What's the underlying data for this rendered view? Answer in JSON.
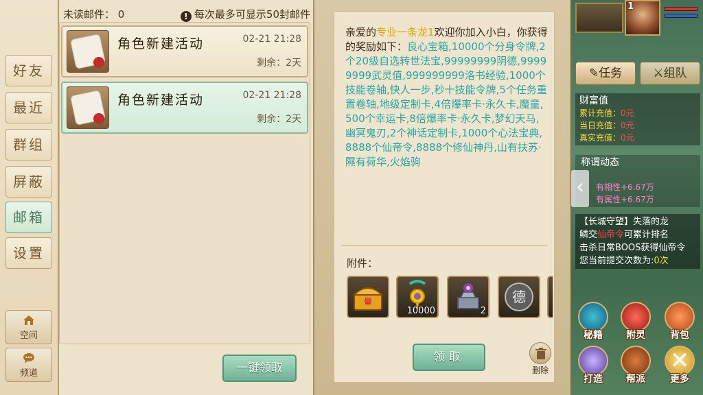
{
  "nav": {
    "tabs": [
      {
        "label": "好友",
        "active": false
      },
      {
        "label": "最近",
        "active": false
      },
      {
        "label": "群组",
        "active": false
      },
      {
        "label": "屏蔽",
        "active": false
      },
      {
        "label": "邮箱",
        "active": true
      },
      {
        "label": "设置",
        "active": false
      }
    ],
    "space_label": "空间",
    "channel_label": "频道"
  },
  "mail": {
    "unread_label": "未读邮件：",
    "unread_count": "0",
    "limit_notice": "每次最多可显示50封邮件",
    "items": [
      {
        "title": "角色新建活动",
        "date": "02-21 21:28",
        "remaining": "剩余：2天",
        "selected": false
      },
      {
        "title": "角色新建活动",
        "date": "02-21 21:28",
        "remaining": "剩余：2天",
        "selected": true
      }
    ],
    "claim_all_label": "一键领取"
  },
  "detail": {
    "greeting": "亲爱的",
    "player_name": "专业一条龙1",
    "welcome": "欢迎你加入小白，你获得的奖励如下：",
    "rewards": "良心宝箱,10000个分身令牌,2个20级自选转世法宝,99999999阴德,99999999武灵值,999999999洛书经验,1000个技能卷轴,快人一步,秒十技能令牌,5个任务重置卷轴,地级定制卡,4倍爆率卡·永久卡,魔童,500个幸运卡,8倍爆率卡·永久卡,梦幻天马,幽冥鬼刃,2个神话定制卡,1000个心法宝典,8888个仙帝令,8888个修仙神丹,山有扶苏·隰有荷华,火焰驹",
    "attachments_label": "附件：",
    "attachments": [
      {
        "icon": "treasure-chest-icon",
        "qty": ""
      },
      {
        "icon": "amulet-icon",
        "qty": "10000"
      },
      {
        "icon": "mystic-altar-icon",
        "qty": "2"
      },
      {
        "icon": "virtue-orb-icon",
        "qty": "",
        "glyph": "德"
      }
    ],
    "claim_label": "领取",
    "delete_label": "删除"
  },
  "hud": {
    "level": "1",
    "quest_tab": "任务",
    "team_tab": "组队",
    "wealth": {
      "title": "财富值",
      "rows": [
        {
          "label": "累计充值：",
          "value": "0元"
        },
        {
          "label": "当日充值：",
          "value": "0元"
        },
        {
          "label": "真实充值：",
          "value": "0元"
        }
      ]
    },
    "title_news": {
      "title": "称谓动态",
      "line1": "有相性+6.67万",
      "line2": "有属性+6.67万"
    },
    "quest": {
      "line1": "【长城守望】失落的龙",
      "line2_prefix": "鳞交",
      "line2_item": "仙帝令",
      "line2_suffix": "可累计排名",
      "line3": "击杀日常BOOS获得仙帝令",
      "line4_prefix": "您当前提交次数为:",
      "line4_count": "0次"
    },
    "buttons": {
      "secret": "秘籍",
      "spirit": "附灵",
      "bag": "背包",
      "forge": "打造",
      "guild": "帮派",
      "more": "更多"
    }
  }
}
